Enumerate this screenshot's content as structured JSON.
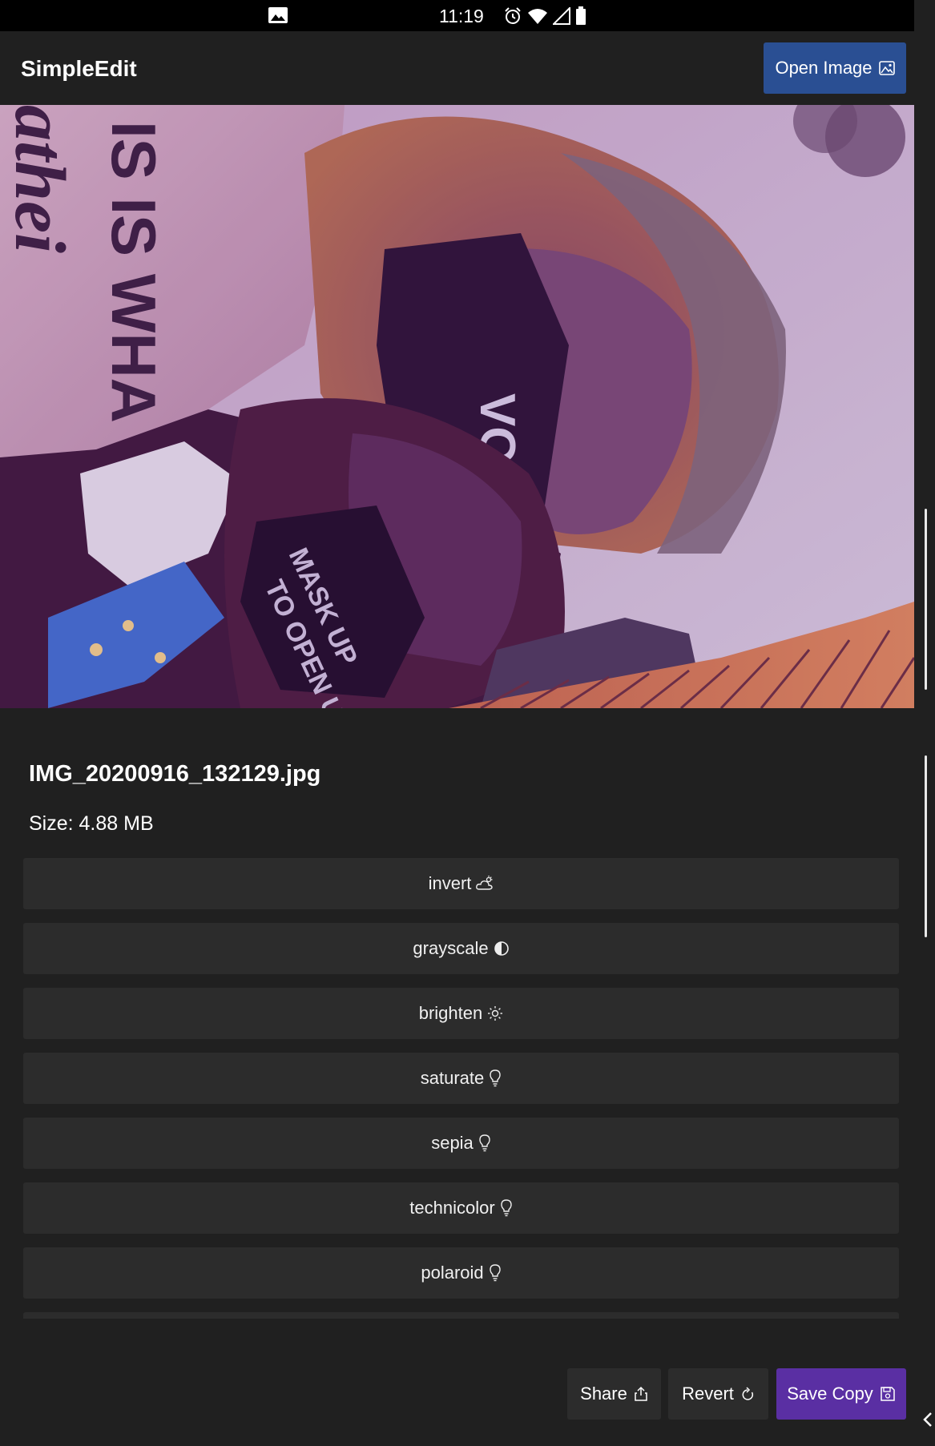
{
  "status_bar": {
    "time": "11:19",
    "icons": [
      "gallery-icon",
      "alarm-icon",
      "wifi-icon",
      "signal-icon",
      "battery-icon"
    ]
  },
  "app_bar": {
    "title": "SimpleEdit",
    "open_button": {
      "label": "Open Image",
      "icon": "image-icon"
    }
  },
  "image": {
    "filename": "IMG_20200916_132129.jpg",
    "size_text": "Size: 4.88 MB"
  },
  "filters": [
    {
      "label": "invert",
      "icon": "cloud-sun-icon"
    },
    {
      "label": "grayscale",
      "icon": "contrast-icon"
    },
    {
      "label": "brighten",
      "icon": "sun-icon"
    },
    {
      "label": "saturate",
      "icon": "lightbulb-icon"
    },
    {
      "label": "sepia",
      "icon": "lightbulb-icon"
    },
    {
      "label": "technicolor",
      "icon": "lightbulb-icon"
    },
    {
      "label": "polaroid",
      "icon": "lightbulb-icon"
    }
  ],
  "bottom_bar": {
    "share": {
      "label": "Share",
      "icon": "share-icon"
    },
    "revert": {
      "label": "Revert",
      "icon": "refresh-icon"
    },
    "save_copy": {
      "label": "Save Copy",
      "icon": "save-icon"
    }
  },
  "colors": {
    "background": "#202020",
    "button": "#2c2c2c",
    "open_button": "#2a4f93",
    "save_button": "#5a2fa3"
  }
}
